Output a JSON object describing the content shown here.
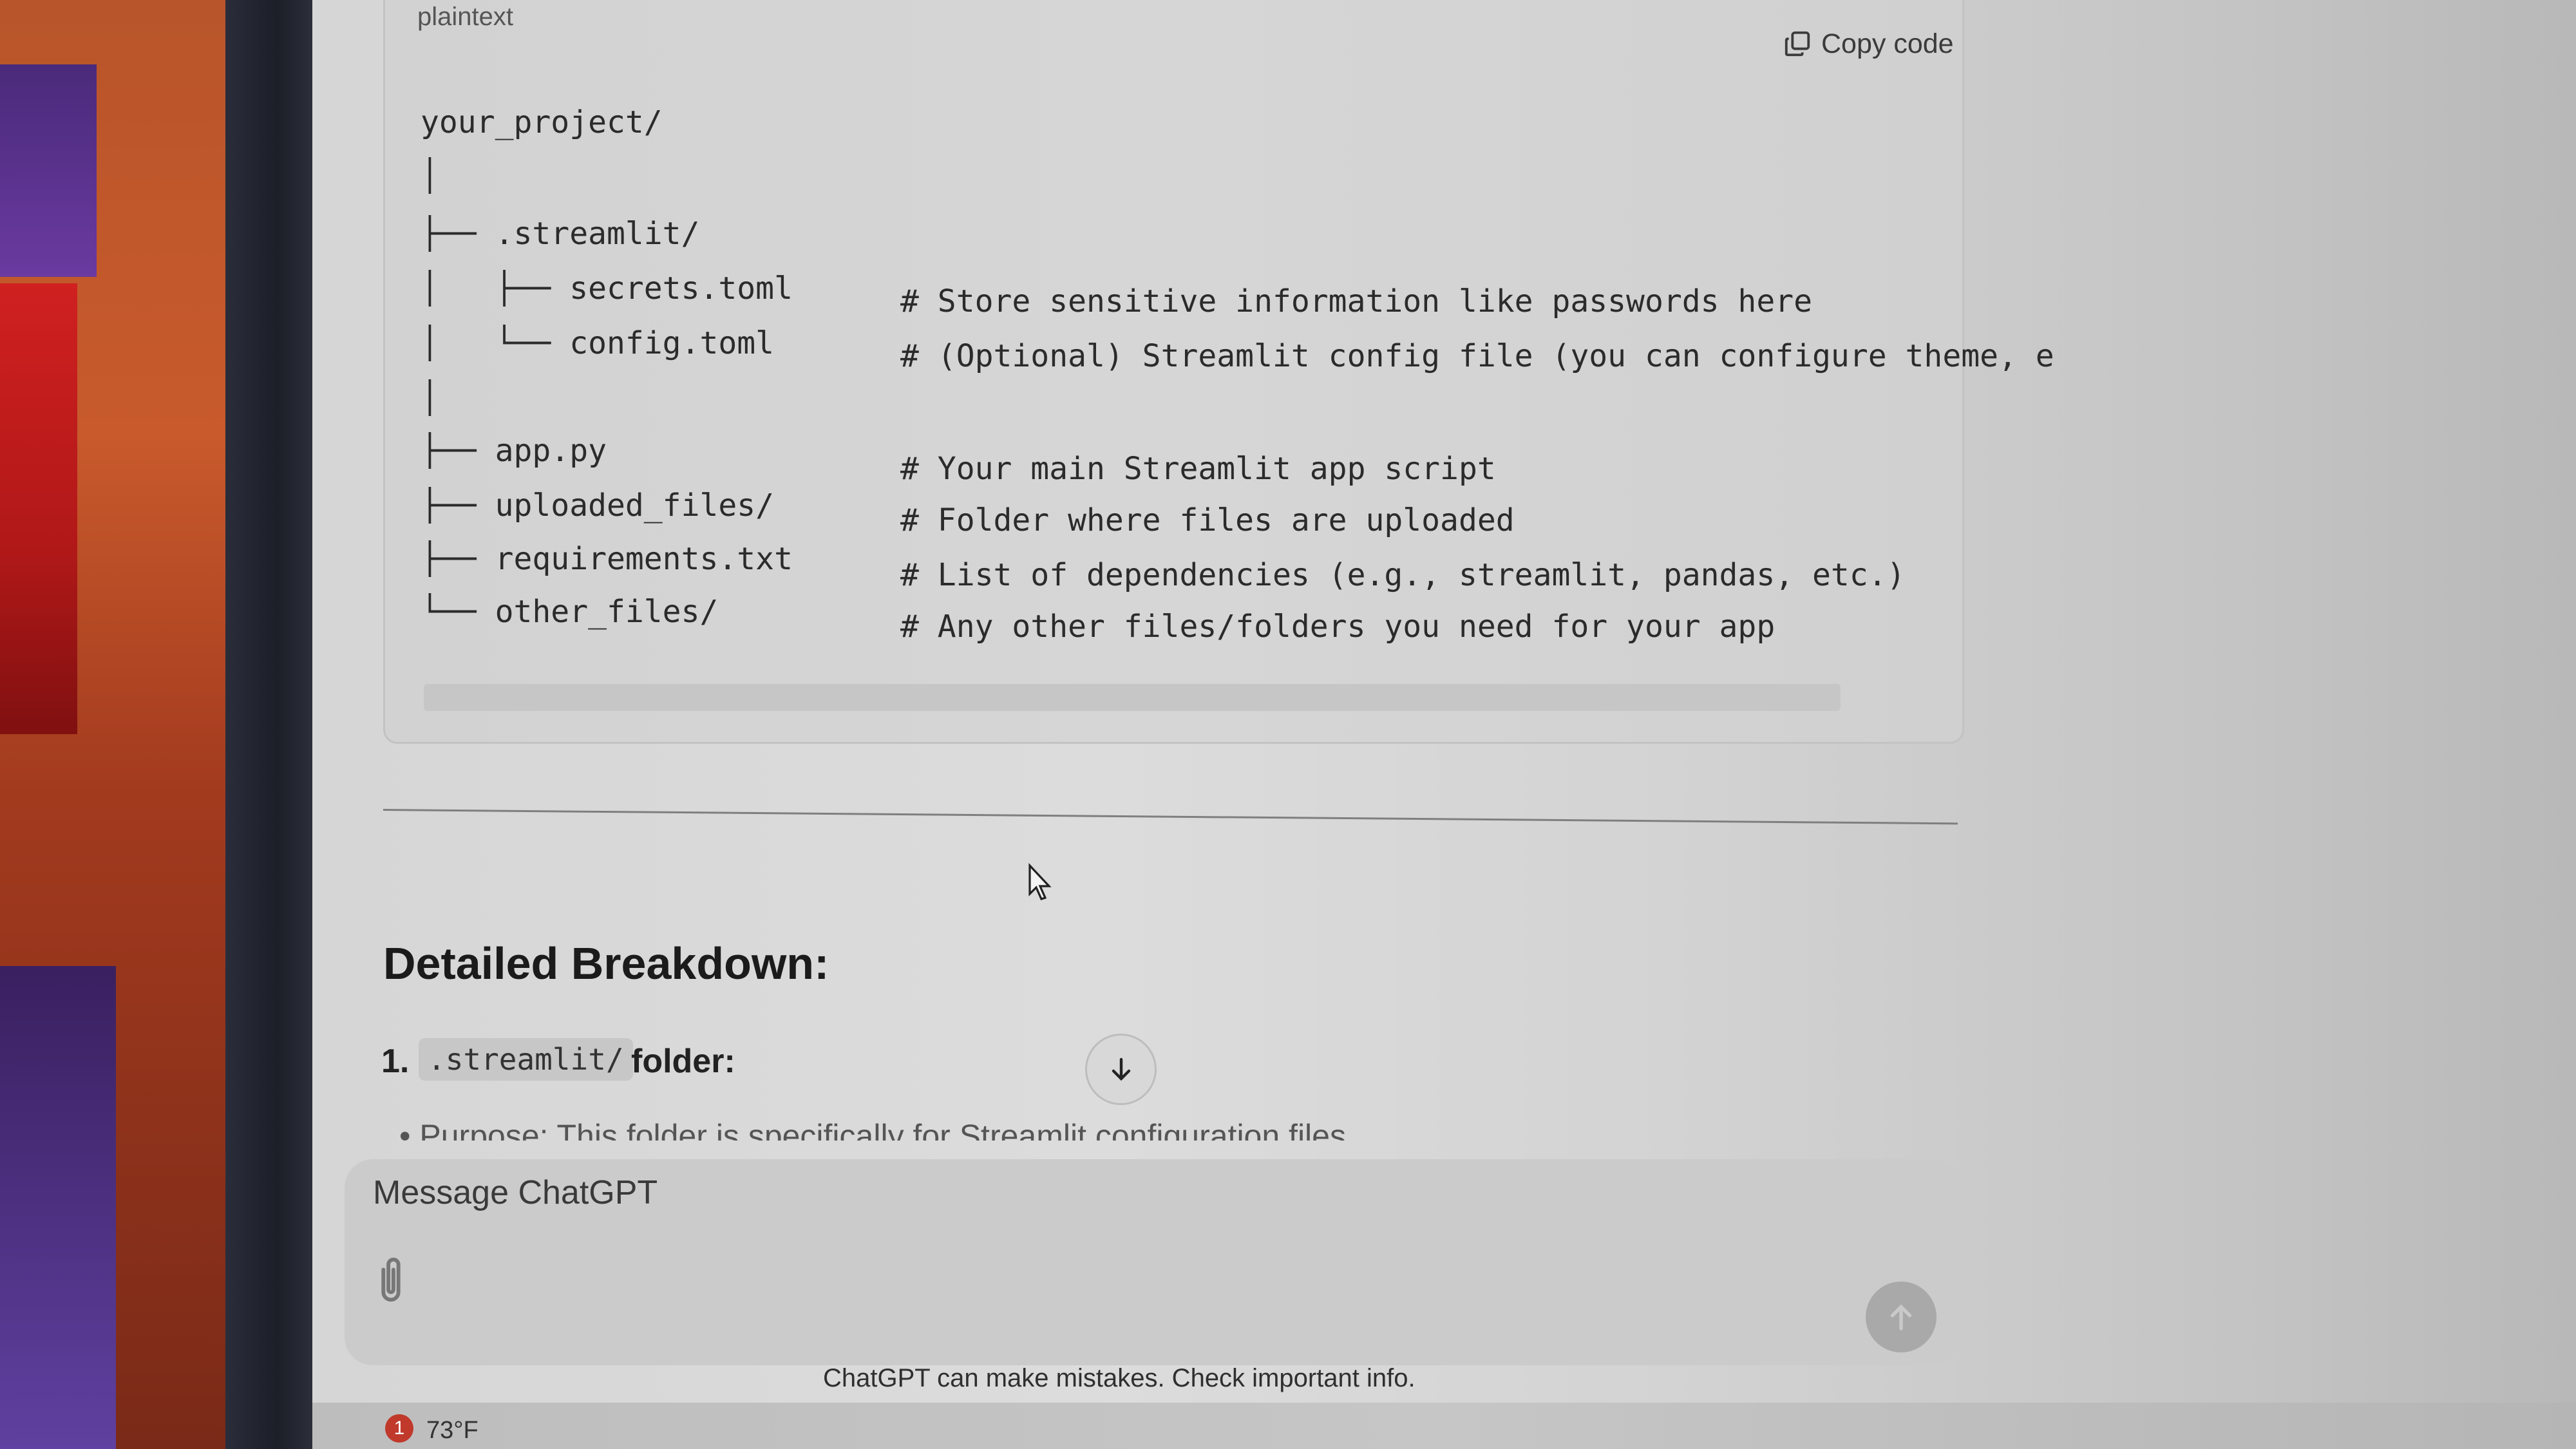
{
  "code_block": {
    "language": "plaintext",
    "copy_label": "Copy code",
    "lines": [
      {
        "tree": "your_project/",
        "comment": ""
      },
      {
        "tree": "│",
        "comment": ""
      },
      {
        "tree": "├── .streamlit/",
        "comment": ""
      },
      {
        "tree": "│   ├── secrets.toml",
        "comment": "# Store sensitive information like passwords here"
      },
      {
        "tree": "│   └── config.toml",
        "comment": "# (Optional) Streamlit config file (you can configure theme, e"
      },
      {
        "tree": "│",
        "comment": ""
      },
      {
        "tree": "├── app.py",
        "comment": "# Your main Streamlit app script"
      },
      {
        "tree": "├── uploaded_files/",
        "comment": "# Folder where files are uploaded"
      },
      {
        "tree": "├── requirements.txt",
        "comment": "# List of dependencies (e.g., streamlit, pandas, etc.)"
      },
      {
        "tree": "└── other_files/",
        "comment": "# Any other files/folders you need for your app"
      }
    ]
  },
  "content": {
    "heading": "Detailed Breakdown:",
    "list_number": "1.",
    "list_code": ".streamlit/",
    "list_text": "folder:",
    "cutoff_text": "• Purpose: This folder is specifically for Streamlit configuration files"
  },
  "composer": {
    "placeholder": "Message ChatGPT"
  },
  "disclaimer": "ChatGPT can make mistakes. Check important info.",
  "taskbar": {
    "badge": "1",
    "weather": "73°F"
  },
  "icons": {
    "copy": "copy-icon",
    "attach": "paperclip-icon",
    "send": "arrow-up-icon",
    "scroll": "arrow-down-icon",
    "cursor": "mouse-pointer-icon"
  }
}
